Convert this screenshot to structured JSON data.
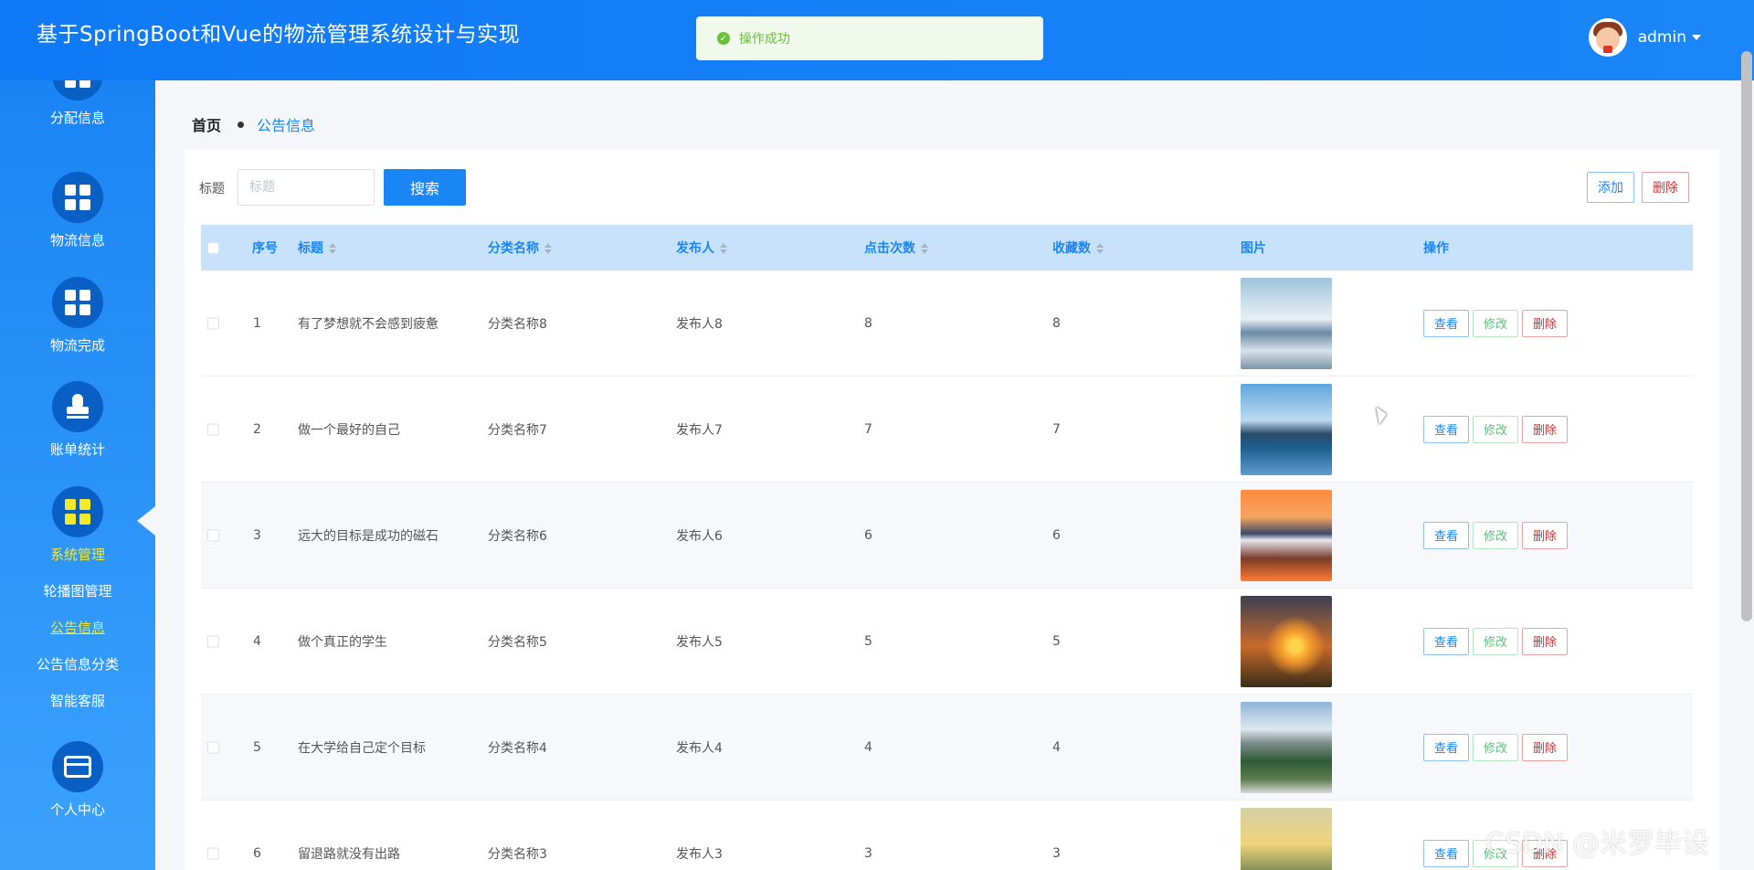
{
  "header": {
    "title": "基于SpringBoot和Vue的物流管理系统设计与实现",
    "user": "admin"
  },
  "toast": {
    "text": "操作成功",
    "color": "#67c23a"
  },
  "sidebar": {
    "items": [
      {
        "label": "分配信息",
        "icon": "grid-icon"
      },
      {
        "label": "物流信息",
        "icon": "grid-icon"
      },
      {
        "label": "物流完成",
        "icon": "grid-icon"
      },
      {
        "label": "账单统计",
        "icon": "stamp-icon"
      },
      {
        "label": "系统管理",
        "icon": "grid-icon",
        "active": true
      },
      {
        "label": "个人中心",
        "icon": "card-icon"
      }
    ],
    "submenu": [
      "轮播图管理",
      "公告信息",
      "公告信息分类",
      "智能客服"
    ]
  },
  "breadcrumb": {
    "home": "首页",
    "current": "公告信息"
  },
  "search": {
    "label": "标题",
    "placeholder": "标题",
    "button": "搜索"
  },
  "toolbar": {
    "add": "添加",
    "delete": "删除"
  },
  "table": {
    "headers": [
      "序号",
      "标题",
      "分类名称",
      "发布人",
      "点击次数",
      "收藏数",
      "图片",
      "操作"
    ],
    "actions": [
      "查看",
      "修改",
      "删除"
    ],
    "rows": [
      {
        "index": "1",
        "title": "有了梦想就不会感到疲惫",
        "category": "分类名称8",
        "author": "发布人8",
        "clicks": "8",
        "favorites": "8",
        "image": "snowy-mountain"
      },
      {
        "index": "2",
        "title": "做一个最好的自己",
        "category": "分类名称7",
        "author": "发布人7",
        "clicks": "7",
        "favorites": "7",
        "image": "lake-mountain"
      },
      {
        "index": "3",
        "title": "远大的目标是成功的磁石",
        "category": "分类名称6",
        "author": "发布人6",
        "clicks": "6",
        "favorites": "6",
        "image": "sunset-reflection"
      },
      {
        "index": "4",
        "title": "做个真正的学生",
        "category": "分类名称5",
        "author": "发布人5",
        "clicks": "5",
        "favorites": "5",
        "image": "sunset-grass"
      },
      {
        "index": "5",
        "title": "在大学给自己定个目标",
        "category": "分类名称4",
        "author": "发布人4",
        "clicks": "4",
        "favorites": "4",
        "image": "valley-buildings"
      },
      {
        "index": "6",
        "title": "留退路就没有出路",
        "category": "分类名称3",
        "author": "发布人3",
        "clicks": "3",
        "favorites": "3",
        "image": "sunrise-field"
      }
    ]
  },
  "watermark": "CSDN @米罗毕设",
  "colors": {
    "primary": "#1a85f5",
    "success": "#67c23a",
    "danger": "#d03030",
    "active_menu": "#f4ea2a"
  }
}
